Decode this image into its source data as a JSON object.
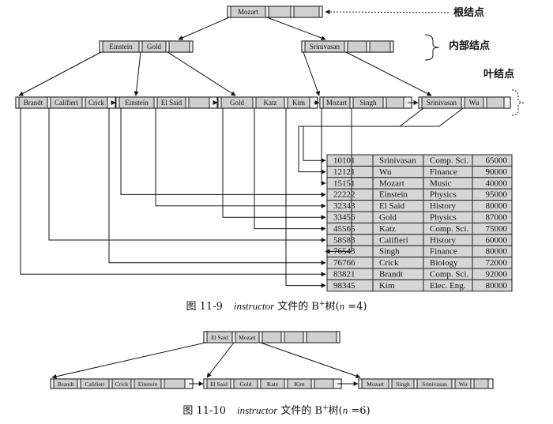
{
  "figure1": {
    "root": [
      "Mozart"
    ],
    "internal": [
      [
        "Einstein",
        "Gold"
      ],
      [
        "Srinivasan"
      ]
    ],
    "leaves": [
      [
        "Brandt",
        "Califieri",
        "Crick"
      ],
      [
        "Einstein",
        "El Said"
      ],
      [
        "Gold",
        "Katz",
        "Kim"
      ],
      [
        "Mozart",
        "Singh"
      ],
      [
        "Srinivasan",
        "Wu"
      ]
    ],
    "labels": {
      "root": "根结点",
      "internal": "内部结点",
      "leaf": "叶结点"
    },
    "table": [
      [
        "10101",
        "Srinivasan",
        "Comp. Sci.",
        "65000"
      ],
      [
        "12121",
        "Wu",
        "Finance",
        "90000"
      ],
      [
        "15151",
        "Mozart",
        "Music",
        "40000"
      ],
      [
        "22222",
        "Einstein",
        "Physics",
        "95000"
      ],
      [
        "32343",
        "El Said",
        "History",
        "80000"
      ],
      [
        "33456",
        "Gold",
        "Physics",
        "87000"
      ],
      [
        "45565",
        "Katz",
        "Comp. Sci.",
        "75000"
      ],
      [
        "58583",
        "Califieri",
        "History",
        "60000"
      ],
      [
        "76543",
        "Singh",
        "Finance",
        "80000"
      ],
      [
        "76766",
        "Crick",
        "Biology",
        "72000"
      ],
      [
        "83821",
        "Brandt",
        "Comp. Sci.",
        "92000"
      ],
      [
        "98345",
        "Kim",
        "Elec. Eng.",
        "80000"
      ]
    ],
    "caption": {
      "prefix": "图 11-9",
      "subject": "instructor",
      "middle": " 文件的 B",
      "sup": "+",
      "tree": "树(",
      "n": "n",
      "eq": " =4)"
    }
  },
  "figure2": {
    "root": [
      "El Said",
      "Mozart"
    ],
    "leaves": [
      [
        "Brandt",
        "Califieri",
        "Crick",
        "Einstein"
      ],
      [
        "El Said",
        "Gold",
        "Katz",
        "Kim"
      ],
      [
        "Mozart",
        "Singh",
        "Srinivasan",
        "Wu"
      ]
    ],
    "caption": {
      "prefix": "图 11-10",
      "subject": "instructor",
      "middle": " 文件的 B",
      "sup": "+",
      "tree": "树(",
      "n": "n",
      "eq": " =6)"
    }
  }
}
